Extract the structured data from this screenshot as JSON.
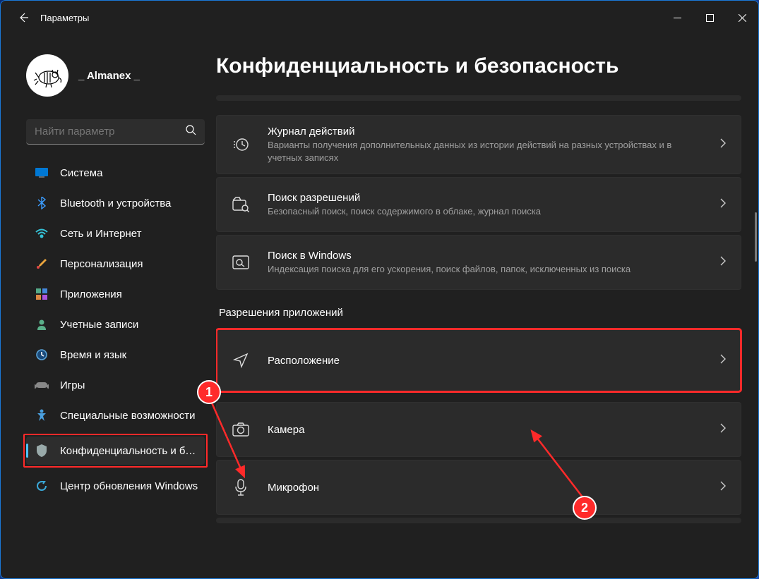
{
  "window": {
    "title": "Параметры"
  },
  "profile": {
    "username": "_ Almanex _"
  },
  "search": {
    "placeholder": "Найти параметр"
  },
  "nav": {
    "items": [
      {
        "label": "Система",
        "icon": "system"
      },
      {
        "label": "Bluetooth и устройства",
        "icon": "bluetooth"
      },
      {
        "label": "Сеть и Интернет",
        "icon": "wifi"
      },
      {
        "label": "Персонализация",
        "icon": "personalize"
      },
      {
        "label": "Приложения",
        "icon": "apps"
      },
      {
        "label": "Учетные записи",
        "icon": "accounts"
      },
      {
        "label": "Время и язык",
        "icon": "time"
      },
      {
        "label": "Игры",
        "icon": "gaming"
      },
      {
        "label": "Специальные возможности",
        "icon": "accessibility"
      },
      {
        "label": "Конфиденциальность и безопас",
        "icon": "privacy"
      },
      {
        "label": "Центр обновления Windows",
        "icon": "update"
      }
    ],
    "selected_index": 9
  },
  "main": {
    "heading": "Конфиденциальность и безопасность",
    "cards_top": [
      {
        "title": "Журнал действий",
        "subtitle": "Варианты получения дополнительных данных из истории действий на разных устройствах и в учетных записях",
        "icon": "activity"
      },
      {
        "title": "Поиск разрешений",
        "subtitle": "Безопасный поиск, поиск содержимого в облаке, журнал поиска",
        "icon": "search-perm"
      },
      {
        "title": "Поиск в Windows",
        "subtitle": "Индексация поиска для его ускорения, поиск файлов, папок, исключенных из поиска",
        "icon": "search-windows"
      }
    ],
    "section_title": "Разрешения приложений",
    "cards_permissions": [
      {
        "title": "Расположение",
        "icon": "location"
      },
      {
        "title": "Камера",
        "icon": "camera"
      },
      {
        "title": "Микрофон",
        "icon": "microphone"
      }
    ]
  },
  "annotations": {
    "badge1": "1",
    "badge2": "2"
  }
}
